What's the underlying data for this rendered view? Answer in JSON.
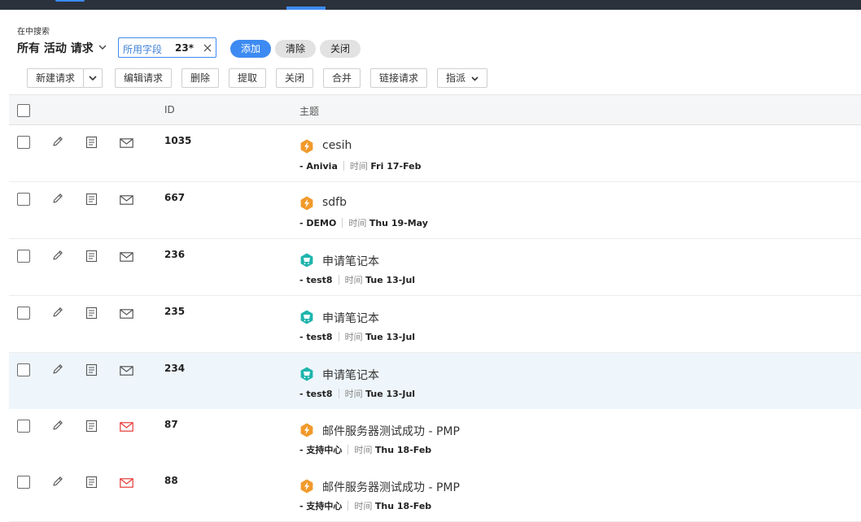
{
  "search_area": {
    "label": "在中搜索",
    "view_title": "所有 活动 请求",
    "field_filter": {
      "name": "所用字段",
      "count": "23*"
    },
    "buttons": {
      "add": "添加",
      "clear": "清除",
      "close": "关闭"
    }
  },
  "toolbar": {
    "new_request": "新建请求",
    "edit_request": "编辑请求",
    "delete": "删除",
    "pickup": "提取",
    "close": "关闭",
    "merge": "合并",
    "link_request": "链接请求",
    "assign": "指派"
  },
  "table": {
    "columns": {
      "id": "ID",
      "subject": "主题"
    },
    "time_label": "时间",
    "rows": [
      {
        "id": "1035",
        "subject": "cesih",
        "requester": "- Anivia",
        "time": "Fri 17-Feb",
        "type_icon": "incident-icon",
        "mail_icon": "mail-icon"
      },
      {
        "id": "667",
        "subject": "sdfb",
        "requester": "- DEMO",
        "time": "Thu 19-May",
        "type_icon": "incident-icon",
        "mail_icon": "mail-icon"
      },
      {
        "id": "236",
        "subject": "申请笔记本",
        "requester": "- test8",
        "time": "Tue 13-Jul",
        "type_icon": "service-request-icon",
        "mail_icon": "mail-icon"
      },
      {
        "id": "235",
        "subject": "申请笔记本",
        "requester": "- test8",
        "time": "Tue 13-Jul",
        "type_icon": "service-request-icon",
        "mail_icon": "mail-icon"
      },
      {
        "id": "234",
        "subject": "申请笔记本",
        "requester": "- test8",
        "time": "Tue 13-Jul",
        "type_icon": "service-request-icon",
        "mail_icon": "mail-icon"
      },
      {
        "id": "87",
        "subject": "邮件服务器测试成功 - PMP",
        "requester": "- 支持中心",
        "time": "Thu 18-Feb",
        "type_icon": "incident-icon",
        "mail_icon": "mail-unread-icon"
      },
      {
        "id": "88",
        "subject": "邮件服务器测试成功 - PMP",
        "requester": "- 支持中心",
        "time": "Thu 18-Feb",
        "type_icon": "incident-icon",
        "mail_icon": "mail-unread-icon"
      }
    ]
  },
  "colors": {
    "accent": "#3d8bf2",
    "incident": "#f19a2b",
    "service_request": "#1fb5ad",
    "unread_mail": "#e53935",
    "top_bar": "#2b323c"
  }
}
